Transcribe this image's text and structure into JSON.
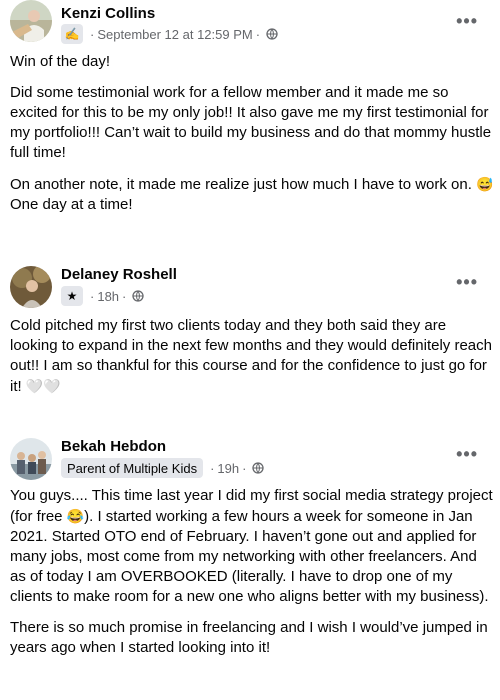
{
  "posts": [
    {
      "author": "Kenzi Collins",
      "badge_icon": "writing-hand-icon",
      "time": "September 12 at 12:59 PM",
      "privacy_icon": "globe-icon",
      "paragraphs": [
        "Win of the day!",
        "Did some testimonial work for a fellow member and it made me so excited for this to be my only job!! It also gave me my first testimonial for my portfolio!!! Can’t wait to build my business and do that mommy hustle full time!",
        "On another note, it made me realize just how much I have to work on.",
        "One day at a time!"
      ],
      "emoji": "😅"
    },
    {
      "author": "Delaney Roshell",
      "badge_icon": "star-icon",
      "time": "18h",
      "privacy_icon": "globe-icon",
      "paragraphs": [
        "Cold pitched my first two clients today and they both said they are looking to expand in the next few months and they would definitely reach out!! I am so thankful for this course and for the confidence to just go for it!"
      ],
      "trailing_emoji": "🤍🤍"
    },
    {
      "author": "Bekah Hebdon",
      "badge_label": "Parent of Multiple Kids",
      "time": "19h",
      "privacy_icon": "globe-icon",
      "paragraphs": [
        "You guys.... This time last year I did my first social media strategy project (for free",
        "). I started working a few hours a week for someone in Jan 2021. Started OTO end of February. I haven’t gone out and applied for many jobs, most come from my networking with other freelancers. And as of today I am OVERBOOKED (literally. I have to drop one of my clients to make room for a new one who aligns better with my business).",
        "There is so much promise in freelancing and I wish I would’ve jumped in years ago when I started looking into it!"
      ],
      "emoji": "😂"
    }
  ],
  "more_label": "•••",
  "colors": {
    "text": "#050505",
    "meta": "#65676b",
    "badge_bg": "#e4e6eb"
  }
}
